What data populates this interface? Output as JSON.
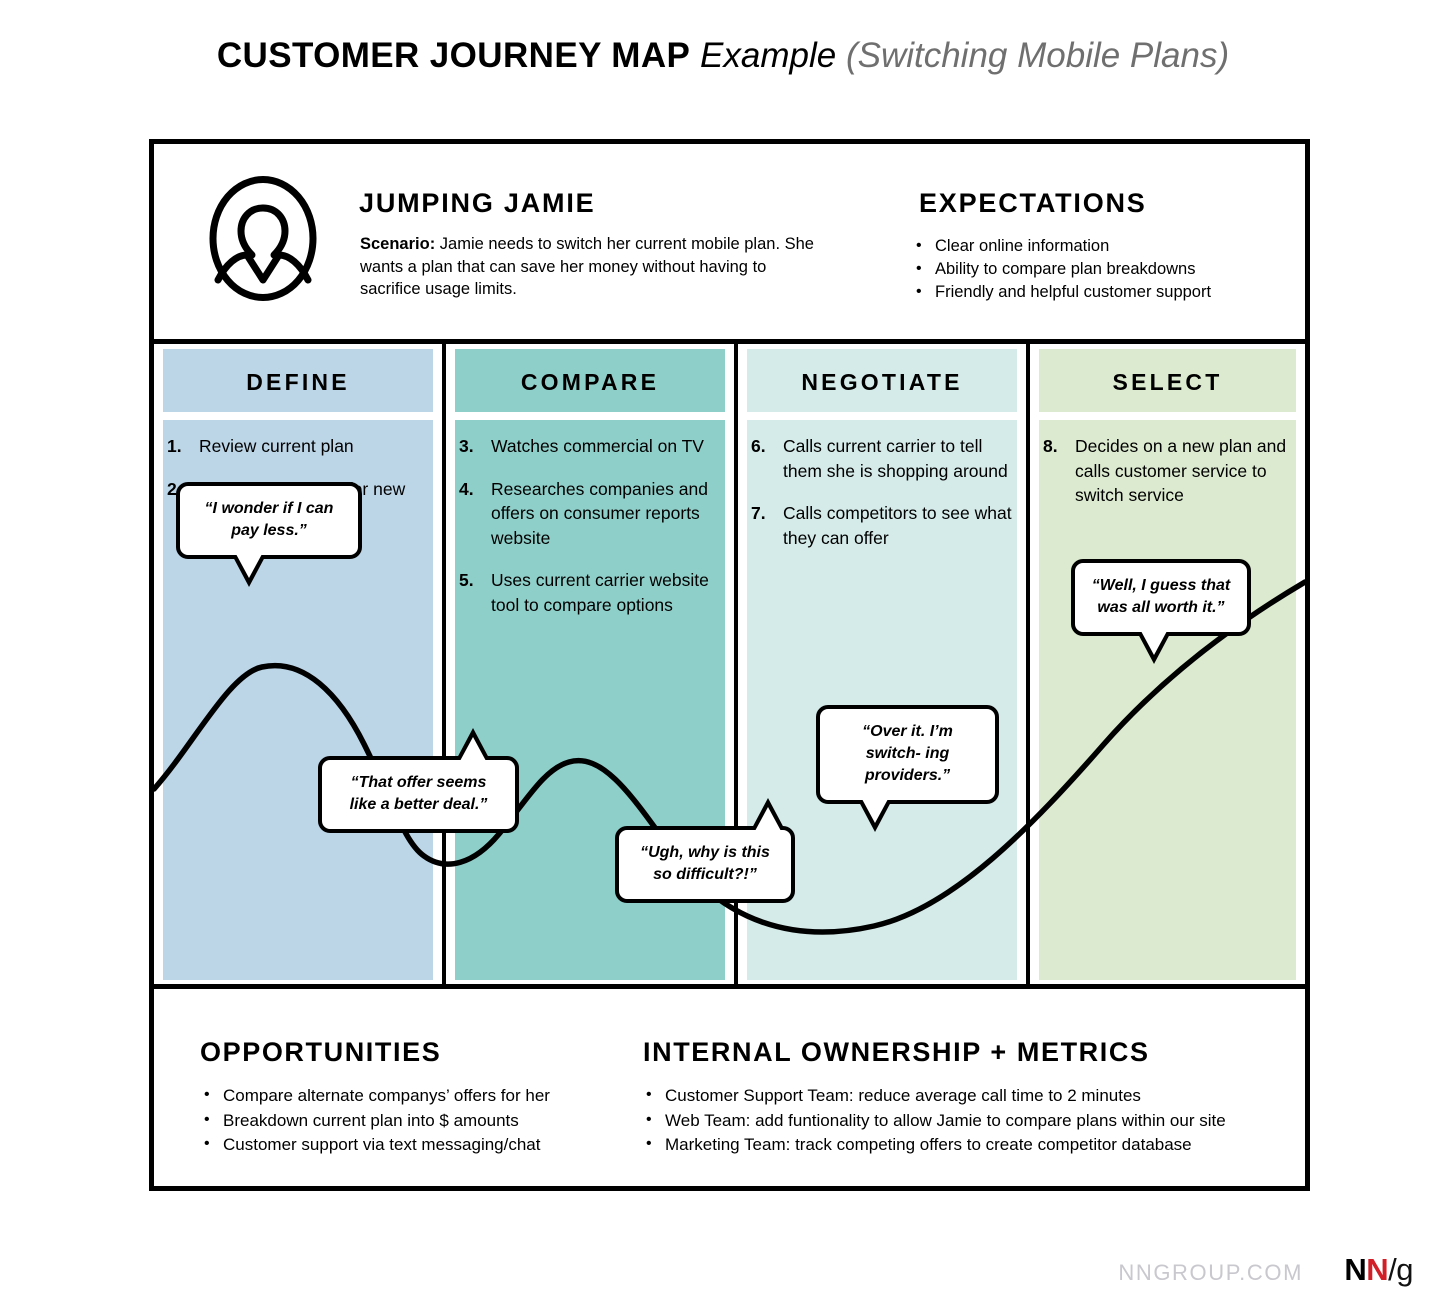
{
  "title": {
    "main": "CUSTOMER JOURNEY MAP",
    "italic": "Example",
    "paren": "(Switching Mobile Plans)"
  },
  "persona": {
    "icon": "person-avatar-icon",
    "name": "JUMPING JAMIE",
    "scenario_label": "Scenario:",
    "scenario_text": " Jamie needs to switch her current mobile plan. She wants a plan that can save her money without having to sacrifice usage limits."
  },
  "expectations": {
    "title": "EXPECTATIONS",
    "items": [
      "Clear online information",
      "Ability to compare plan breakdowns",
      "Friendly and helpful customer support"
    ]
  },
  "phases": [
    {
      "label": "DEFINE",
      "color": "#bcd6e8",
      "steps": [
        {
          "num": "1.",
          "text": "Review current plan"
        },
        {
          "num": "2.",
          "text": "Define parameters for new plan"
        }
      ]
    },
    {
      "label": "COMPARE",
      "color": "#8fcfc9",
      "steps": [
        {
          "num": "3.",
          "text": "Watches commercial on TV"
        },
        {
          "num": "4.",
          "text": "Researches companies and offers on consumer reports website"
        },
        {
          "num": "5.",
          "text": "Uses current carrier website tool to compare options"
        }
      ]
    },
    {
      "label": "NEGOTIATE",
      "color": "#d5ebe9",
      "steps": [
        {
          "num": "6.",
          "text": "Calls current carrier to tell them she is shopping around"
        },
        {
          "num": "7.",
          "text": "Calls competitors to see what they can offer"
        }
      ]
    },
    {
      "label": "SELECT",
      "color": "#dcead0",
      "steps": [
        {
          "num": "8.",
          "text": "Decides on a new plan and calls customer service to switch service"
        }
      ]
    }
  ],
  "quotes": [
    {
      "text": "“I wonder if I can pay less.”",
      "tail": "down"
    },
    {
      "text": "“That offer seems like a better deal.”",
      "tail": "up"
    },
    {
      "text": "“Ugh, why is this so difficult?!”",
      "tail": "up"
    },
    {
      "text": "“Over it. I’m switch- ing providers.”",
      "tail": "down"
    },
    {
      "text": "“Well, I guess that was all worth it.”",
      "tail": "down"
    }
  ],
  "opportunities": {
    "title": "OPPORTUNITIES",
    "items": [
      "Compare alternate companys’ offers for her",
      "Breakdown current plan into $ amounts",
      "Customer support via text messaging/chat"
    ]
  },
  "ownership": {
    "title": "INTERNAL OWNERSHIP + METRICS",
    "items": [
      "Customer Support Team: reduce average call time to 2 minutes",
      "Web Team: add funtionality to allow Jamie to compare plans within our site",
      "Marketing Team: track competing offers to create competitor database"
    ]
  },
  "footer": {
    "url": "NNGROUP.COM",
    "logo_n1": "N",
    "logo_n2": "N",
    "logo_slash": "/",
    "logo_g": "g"
  }
}
